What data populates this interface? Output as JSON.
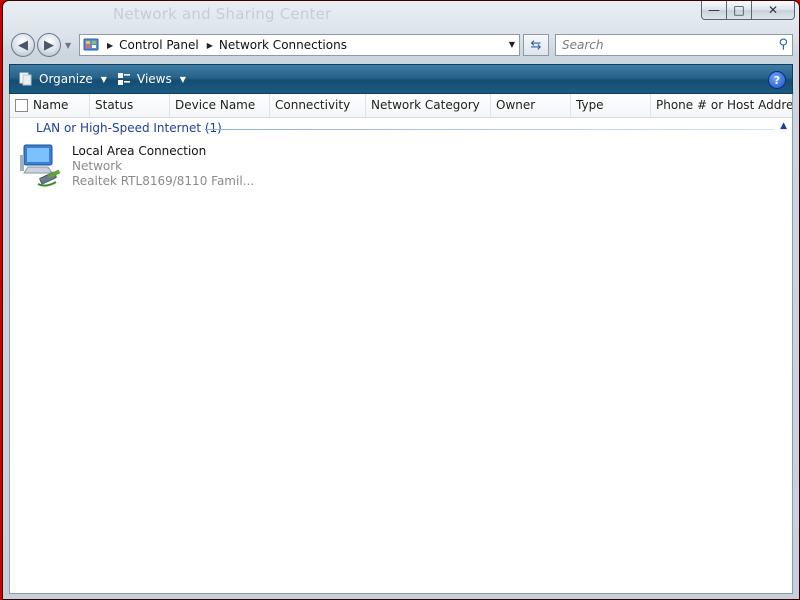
{
  "window": {
    "ghost_title": "Network and Sharing Center",
    "caption": {
      "minimize": "—",
      "maximize": "□",
      "close": "✕"
    }
  },
  "navigation": {
    "back_icon": "back-arrow-icon",
    "forward_icon": "forward-arrow-icon",
    "breadcrumb": [
      "Control Panel",
      "Network Connections"
    ],
    "search_placeholder": "Search"
  },
  "toolbar": {
    "organize_label": "Organize",
    "views_label": "Views",
    "help_label": "?"
  },
  "columns": [
    "Name",
    "Status",
    "Device Name",
    "Connectivity",
    "Network Category",
    "Owner",
    "Type",
    "Phone # or Host Addre..."
  ],
  "group": {
    "label": "LAN or High-Speed Internet (1)"
  },
  "items": [
    {
      "name": "Local Area Connection",
      "status": "Network",
      "device": "Realtek RTL8169/8110 Famil..."
    }
  ],
  "colors": {
    "toolbar": "#1d5a82",
    "group_text": "#1e3f9a",
    "frame": "#c80000"
  }
}
